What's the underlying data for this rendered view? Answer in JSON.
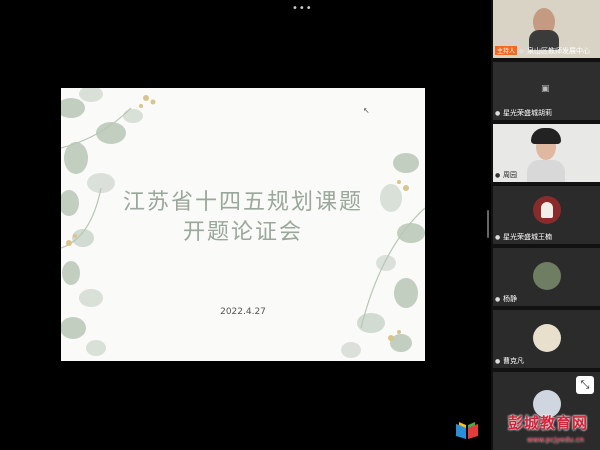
{
  "top_bar": {
    "dots": "•••"
  },
  "slide": {
    "title_line1": "江苏省十四五规划课题",
    "title_line2": "开题论证会",
    "date": "2022.4.27"
  },
  "participants": [
    {
      "name": "泉山区教师发展中心",
      "badge": "主持人"
    },
    {
      "name": "星光荣盛城胡莉"
    },
    {
      "name": "周园"
    },
    {
      "name": "星光荣盛城王楠"
    },
    {
      "name": "杨静"
    },
    {
      "name": "曹克凡"
    },
    {
      "name": ""
    }
  ],
  "watermark": {
    "text": "彭城教育网",
    "url": "www.pcjyedu.cn"
  },
  "colors": {
    "slide_title": "#9aa79b",
    "leaf": "#aebfae",
    "accent": "#f06a22",
    "watermark": "#d4233a"
  }
}
